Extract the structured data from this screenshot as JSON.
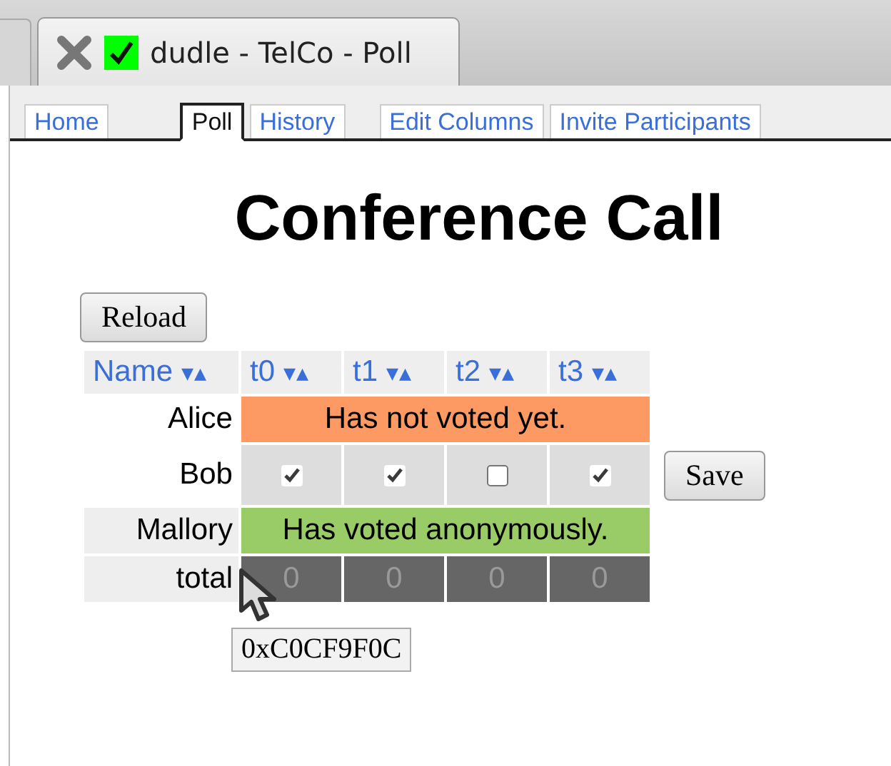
{
  "browser_tab": {
    "title": "dudle - TelCo - Poll"
  },
  "nav_tabs": [
    {
      "label": "Home",
      "selected": false
    },
    {
      "label": "Poll",
      "selected": true
    },
    {
      "label": "History",
      "selected": false
    },
    {
      "label": "Edit Columns",
      "selected": false
    },
    {
      "label": "Invite Participants",
      "selected": false
    }
  ],
  "heading": "Conference Call",
  "reload_button": "Reload",
  "table": {
    "columns": [
      {
        "label": "Name",
        "sort": "▾▴"
      },
      {
        "label": "t0",
        "sort": "▾▴"
      },
      {
        "label": "t1",
        "sort": "▾▴"
      },
      {
        "label": "t2",
        "sort": "▾▴"
      },
      {
        "label": "t3",
        "sort": "▾▴"
      }
    ],
    "rows": [
      {
        "kind": "status",
        "name": "Alice",
        "message": "Has not voted yet.",
        "color": "#fd9a63"
      },
      {
        "kind": "votes",
        "name": "Bob",
        "votes": [
          {
            "checked": true
          },
          {
            "checked": true
          },
          {
            "checked": false
          },
          {
            "checked": true
          }
        ],
        "button": "Save"
      },
      {
        "kind": "status",
        "name": "Mallory",
        "message": "Has voted anonymously.",
        "color": "#99cc66"
      },
      {
        "kind": "total",
        "name": "total",
        "totals": [
          "0",
          "0",
          "0",
          "0"
        ]
      }
    ]
  },
  "tooltip": "0xC0CF9F0C"
}
